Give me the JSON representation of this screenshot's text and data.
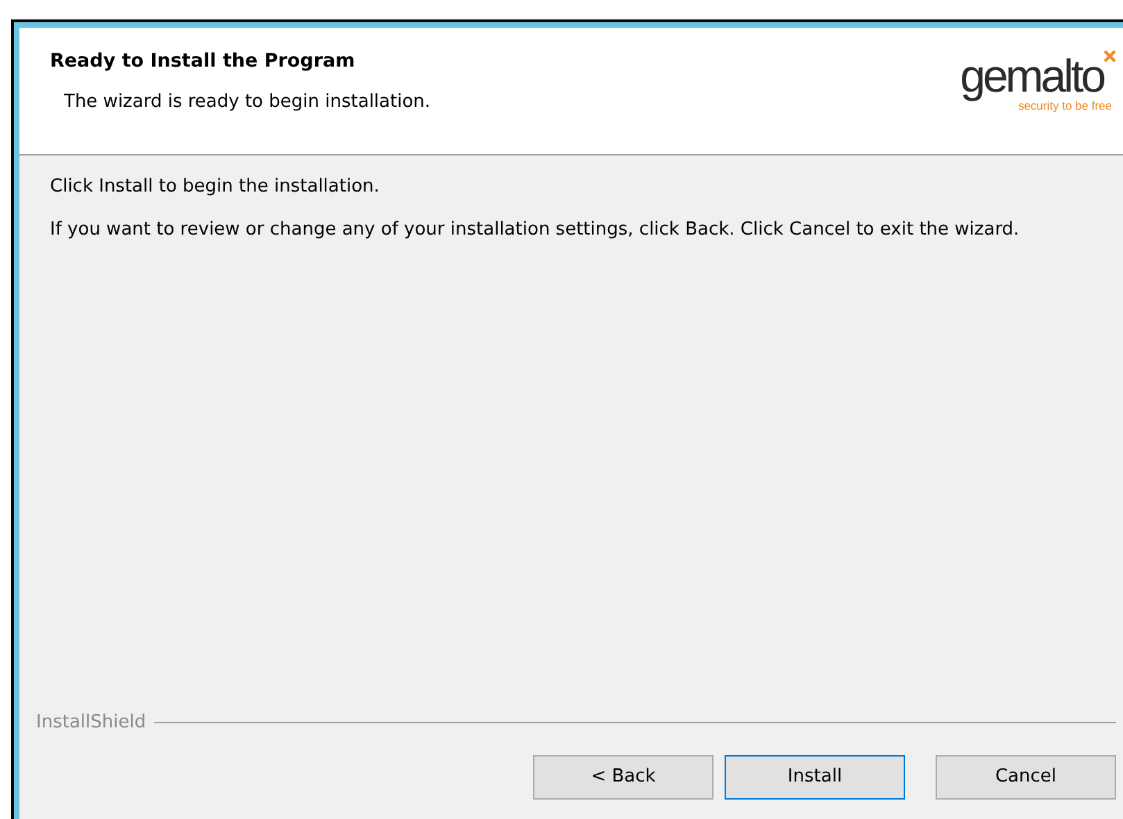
{
  "header": {
    "title": "Ready to Install the Program",
    "subtitle": "The wizard is ready to begin installation.",
    "logo": {
      "name": "gemalto",
      "tagline": "security to be free"
    }
  },
  "body": {
    "paragraphs": [
      "Click Install to begin the installation.",
      "If you want to review or change any of your installation settings, click Back. Click Cancel to exit the wizard."
    ]
  },
  "footer": {
    "brand": "InstallShield"
  },
  "buttons": [
    {
      "label": "< Back",
      "default": false
    },
    {
      "label": "Install",
      "default": true
    },
    {
      "label": "Cancel",
      "default": false
    }
  ]
}
